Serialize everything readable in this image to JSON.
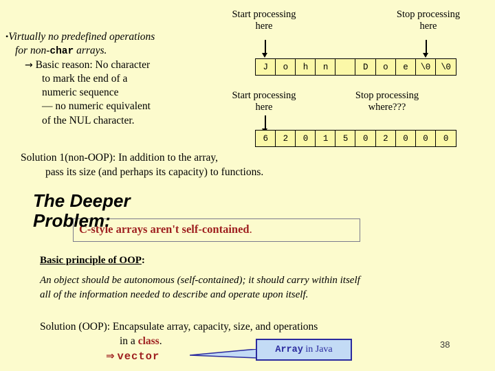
{
  "slide": {
    "background_color": "#fcfbcd",
    "page_number": "38"
  },
  "bullets": {
    "b1_line1_pre": "Virtually no predefined operations",
    "b1_line2_pre": "for non-",
    "b1_line2_mono": "char",
    "b1_line2_post": " arrays.",
    "b2_arrow": "→",
    "b2_line1": "Basic reason: No character",
    "b2_line2": "to mark the end of a",
    "b2_line3": "numeric sequence",
    "b2_line4": "—  no numeric equivalent",
    "b2_line5": "of the NUL character."
  },
  "diagram_char": {
    "start_label_line1": "Start processing",
    "start_label_line2": "here",
    "stop_label_line1": "Stop processing",
    "stop_label_line2": "here",
    "cells": [
      "J",
      "o",
      "h",
      "n",
      "",
      "D",
      "o",
      "e",
      "\\0",
      "\\0"
    ],
    "cell_fill": "#fbf8a8"
  },
  "diagram_numeric": {
    "start_label_line1": "Start processing",
    "start_label_line2": "here",
    "stop_label_line1": "Stop processing",
    "stop_label_line2": "where???",
    "cells": [
      "6",
      "2",
      "0",
      "1",
      "5",
      "0",
      "2",
      "0",
      "0",
      "0"
    ],
    "cell_fill": "#fbf8a8"
  },
  "solution1": {
    "line1": "Solution 1(non-OOP):  In addition to the array,",
    "line2": "pass its size (and perhaps its capacity) to functions."
  },
  "deeper": {
    "heading_line1": "The Deeper",
    "heading_line2": "Problem:",
    "boxed_statement": "C-style arrays aren't self-contained",
    "boxed_statement_period": ".",
    "statement_color": "#9e1f1f"
  },
  "principle": {
    "heading_underlined": "Basic principle of OOP",
    "heading_colon": ":",
    "body_line1": "An object should be autonomous (self-contained); it should carry within itself",
    "body_line2": "all of the information needed to describe and operate upon itself."
  },
  "solution_oop": {
    "line1": "Solution (OOP):  Encapsulate array, capacity, size, and operations",
    "line2_pre": "in a ",
    "line2_kw": "class",
    "line2_post": ".",
    "line3_arrow": "⇒",
    "line3_kw": "vector"
  },
  "java_callout": {
    "label_mono": "Array",
    "label_rest": " in Java",
    "fill_color": "#c3dbf5",
    "border_color": "#2a2a9e"
  }
}
